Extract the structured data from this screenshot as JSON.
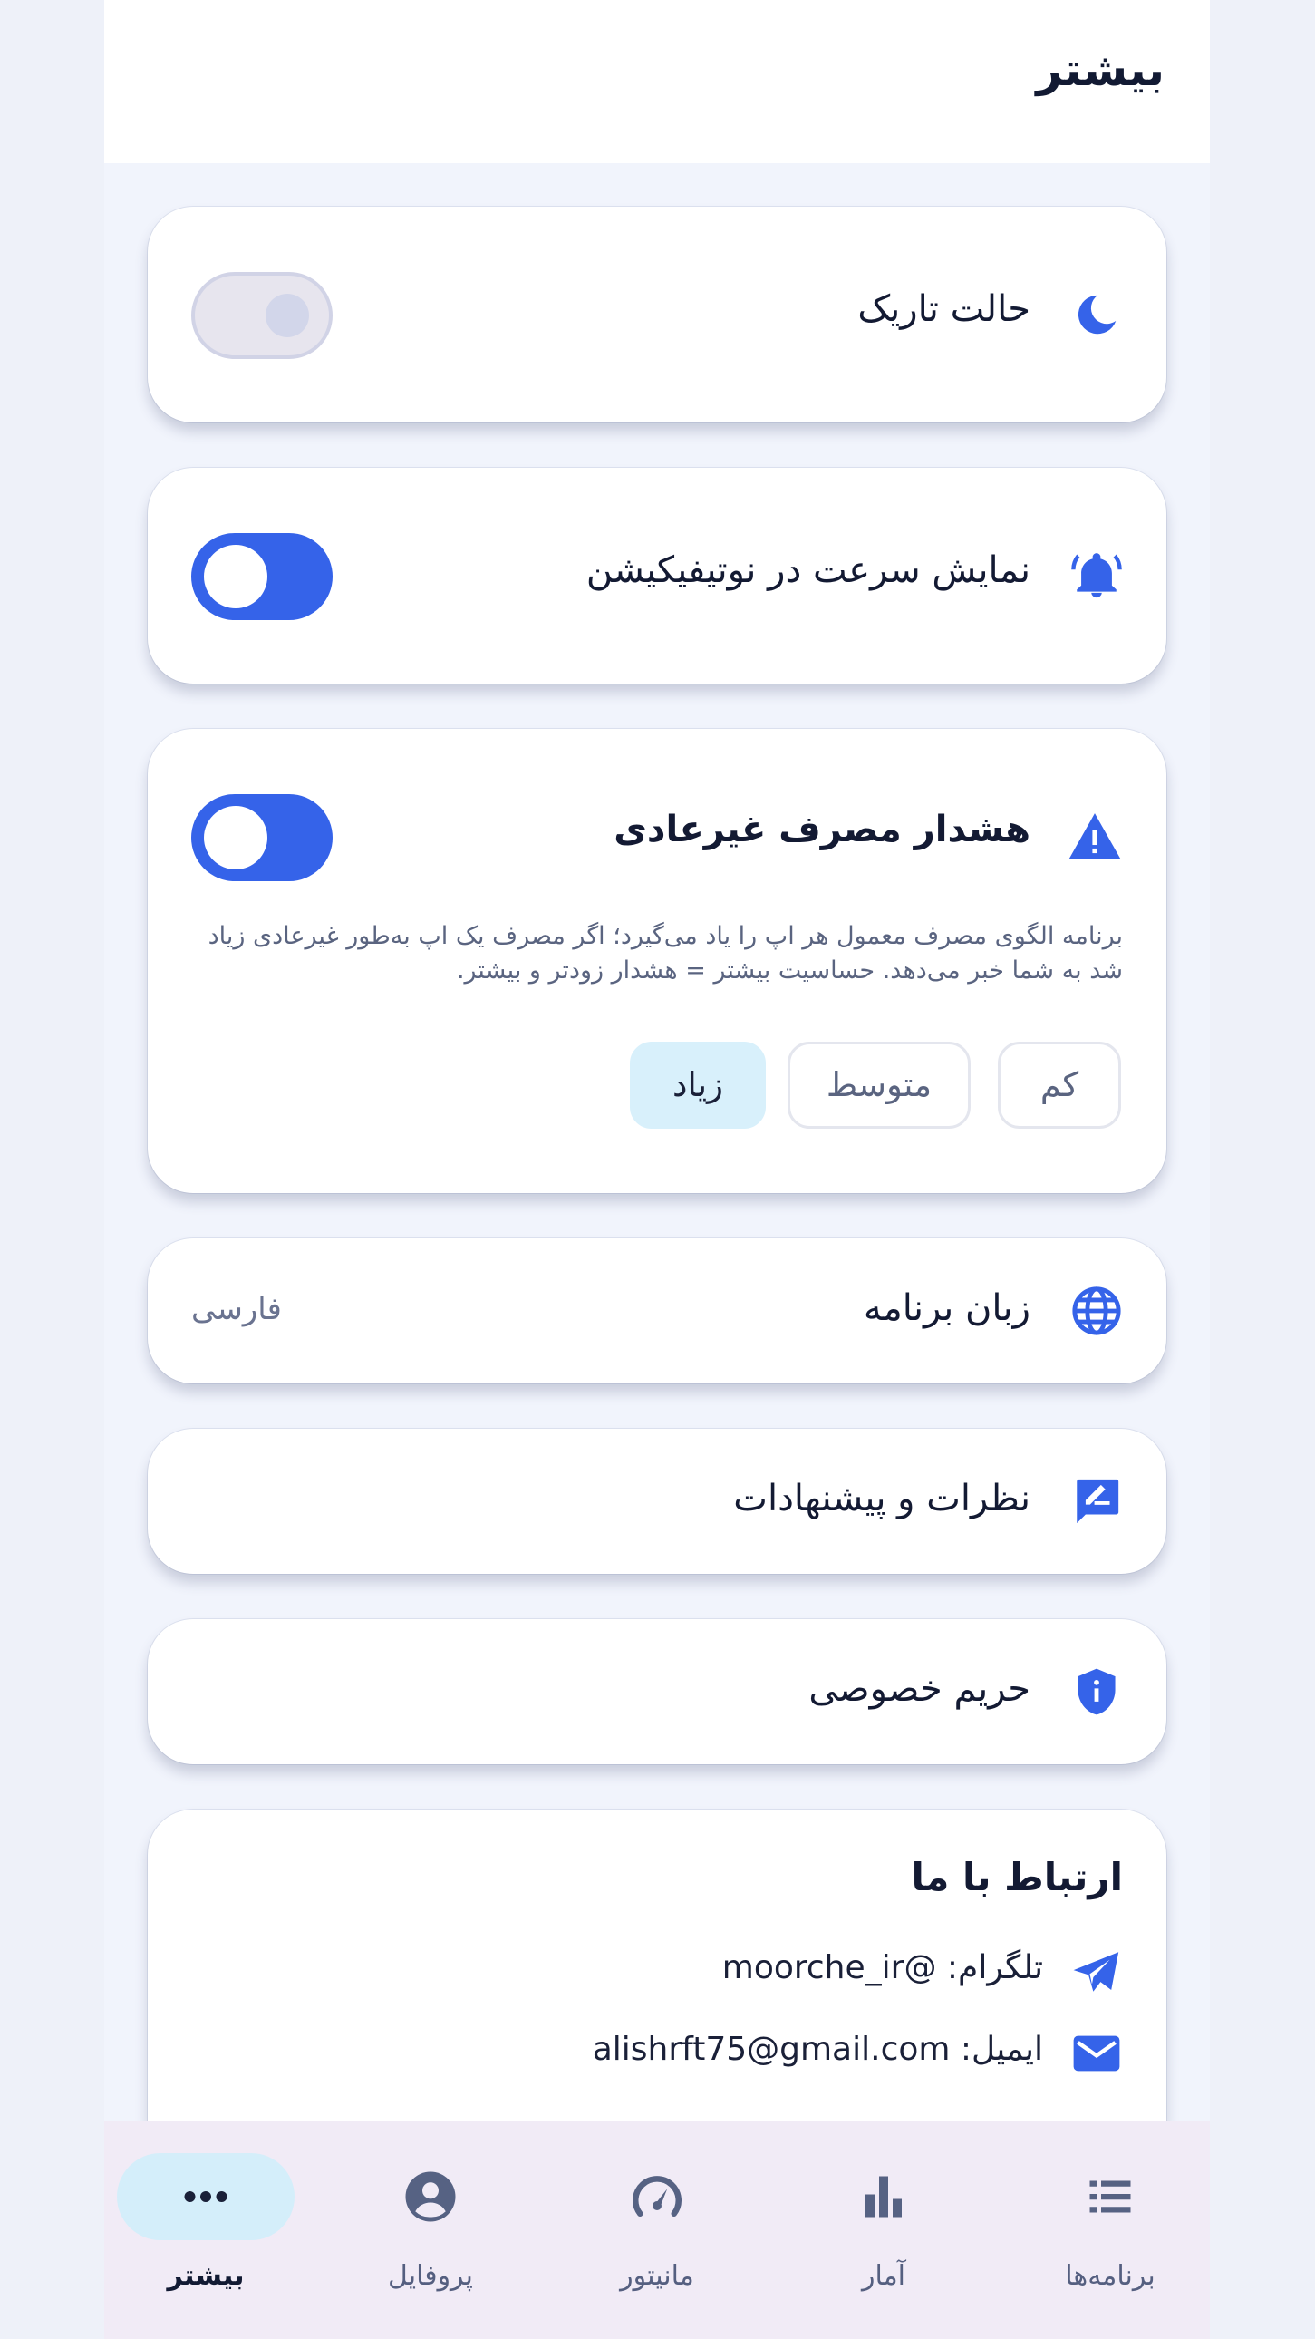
{
  "colors": {
    "accent": "#3563e9",
    "icon_muted": "#566283",
    "active_pill": "#d4eefa"
  },
  "header": {
    "title": "بیشتر"
  },
  "dark_mode": {
    "icon": "moon-icon",
    "label": "حالت تاریک",
    "enabled": false
  },
  "notification_speed": {
    "icon": "bell-icon",
    "label": "نمایش سرعت در نوتیفیکیشن",
    "enabled": true
  },
  "abnormal_usage": {
    "icon": "warning-icon",
    "title": "هشدار مصرف غیرعادی",
    "enabled": true,
    "description": "برنامه الگوی مصرف معمول هر اپ را یاد می‌گیرد؛ اگر مصرف یک اپ به‌طور غیرعادی زیاد شد به شما خبر می‌دهد. حساسیت بیشتر = هشدار زودتر و بیشتر.",
    "sensitivity": {
      "options": [
        "کم",
        "متوسط",
        "زیاد"
      ],
      "selected": "زیاد"
    }
  },
  "language": {
    "icon": "globe-icon",
    "label": "زبان برنامه",
    "value": "فارسی"
  },
  "feedback": {
    "icon": "feedback-icon",
    "label": "نظرات و پیشنهادات"
  },
  "privacy": {
    "icon": "shield-icon",
    "label": "حریم خصوصی"
  },
  "contact": {
    "title": "ارتباط با ما",
    "telegram": "تلگرام: @moorche_ir",
    "email": "ایمیل: alishrft75@gmail.com"
  },
  "bottom_nav": {
    "items": [
      {
        "label": "برنامه‌ها",
        "icon": "list-icon"
      },
      {
        "label": "آمار",
        "icon": "bar-chart-icon"
      },
      {
        "label": "مانیتور",
        "icon": "speedometer-icon"
      },
      {
        "label": "پروفایل",
        "icon": "profile-icon"
      },
      {
        "label": "بیشتر",
        "icon": "more-icon"
      }
    ],
    "active": "بیشتر"
  }
}
